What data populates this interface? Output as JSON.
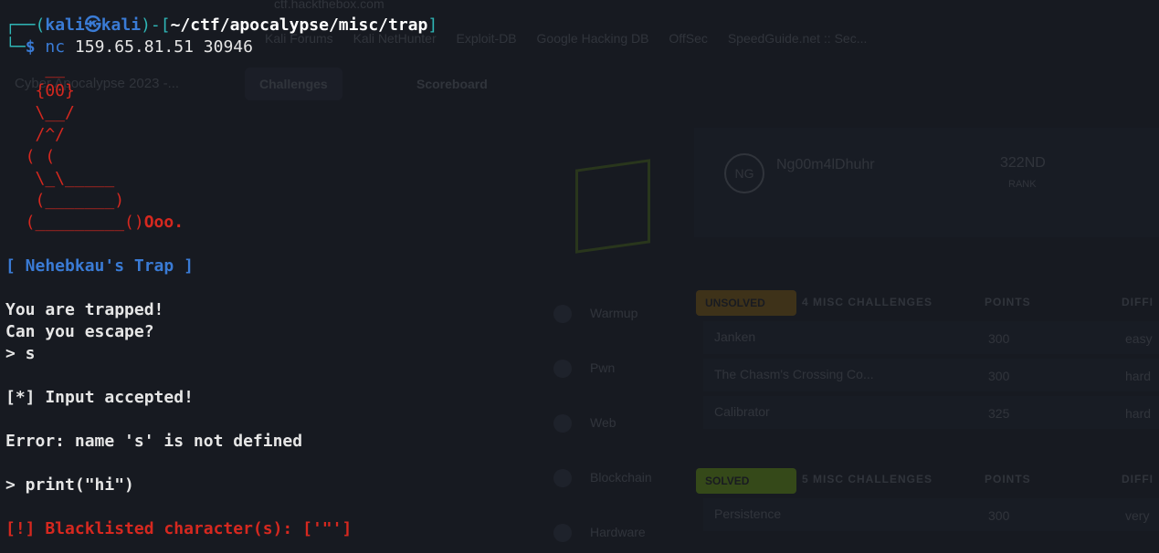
{
  "background": {
    "url": "ctf.hackthebox.com",
    "bookmarks": [
      "Kali Forums",
      "Kali NetHunter",
      "Exploit-DB",
      "Google Hacking DB",
      "OffSec",
      "SpeedGuide.net :: Sec..."
    ],
    "tab_title": "Cyber Apocalypse 2023 -...",
    "nav_tabs": [
      "Challenges",
      "Scoreboard"
    ],
    "profile": {
      "avatar_initials": "NG",
      "name": "Ng00m4lDhuhr",
      "rank": "322ND",
      "rank_label": "RANK"
    },
    "sidebar": [
      "Warmup",
      "Pwn",
      "Web",
      "Blockchain",
      "Hardware"
    ],
    "unsolved_tag": "UNSOLVED",
    "unsolved_header": "4 MISC CHALLENGES",
    "solved_tag": "SOLVED",
    "solved_header": "5 MISC CHALLENGES",
    "points_header": "POINTS",
    "difficulty_header": "DIFFI",
    "challenges": [
      {
        "name": "Janken",
        "points": "300",
        "difficulty": "easy"
      },
      {
        "name": "The Chasm's Crossing Co...",
        "points": "300",
        "difficulty": "hard"
      },
      {
        "name": "Calibrator",
        "points": "325",
        "difficulty": "hard"
      }
    ],
    "solved_challenges": [
      {
        "name": "Persistence",
        "points": "300",
        "difficulty": "very"
      }
    ]
  },
  "terminal": {
    "prompt": {
      "frame_top": "┌──(",
      "user": "kali㉿kali",
      "mid": ")-[",
      "path": "~/ctf/apocalypse/misc/trap",
      "end": "]",
      "frame_bottom": "└─",
      "dollar": "$ "
    },
    "command_name": "nc",
    "command_args": " 159.65.81.51 30946",
    "ascii_art": [
      "    __",
      "   {00}",
      "   \\__/",
      "   /^/",
      "  ( (",
      "   \\_\\_____",
      "   (_______)",
      "  (_________()"
    ],
    "ascii_tail": "Ooo.",
    "title": "[ Nehebkau's Trap ]",
    "lines": [
      "You are trapped!",
      "Can you escape?",
      "> s",
      "",
      "[*] Input accepted!",
      "",
      "Error: name 's' is not defined",
      "",
      "> print(\"hi\")",
      ""
    ],
    "error": "[!] Blacklisted character(s): ['\"']"
  }
}
